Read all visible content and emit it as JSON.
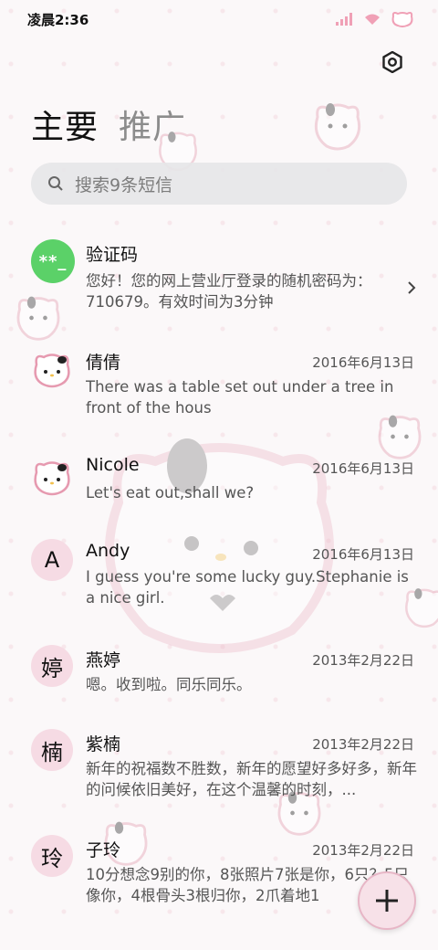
{
  "status_bar": {
    "time": "凌晨2:36"
  },
  "tabs": [
    {
      "label": "主要",
      "active": true
    },
    {
      "label": "推广",
      "active": false
    }
  ],
  "search": {
    "placeholder": "搜索9条短信"
  },
  "conversations": [
    {
      "avatar_type": "code",
      "avatar_text": "**_",
      "name": "验证码",
      "date": "",
      "message": "您好！您的网上营业厅登录的随机密码为：710679。有效时间为3分钟"
    },
    {
      "avatar_type": "kitty",
      "avatar_text": "",
      "name": "倩倩",
      "date": "2016年6月13日",
      "message": "There was a table set out under a tree in front of the hous"
    },
    {
      "avatar_type": "kitty",
      "avatar_text": "",
      "name": "Nicole",
      "date": "2016年6月13日",
      "message": "Let's eat out,shall we?"
    },
    {
      "avatar_type": "letter",
      "avatar_text": "A",
      "name": "Andy",
      "date": "2016年6月13日",
      "message": "I guess you're some lucky guy.Stephanie is a nice girl."
    },
    {
      "avatar_type": "letter",
      "avatar_text": "婷",
      "name": "燕婷",
      "date": "2013年2月22日",
      "message": "嗯。收到啦。同乐同乐。"
    },
    {
      "avatar_type": "letter",
      "avatar_text": "楠",
      "name": "紫楠",
      "date": "2013年2月22日",
      "message": "新年的祝福数不胜数，新年的愿望好多好多，新年的问候依旧美好，在这个温馨的时刻，..."
    },
    {
      "avatar_type": "letter",
      "avatar_text": "玲",
      "name": "子玲",
      "date": "2013年2月22日",
      "message": "10分想念9别的你，8张照片7张是你，6只？5只像你，4根骨头3根归你，2爪着地1"
    }
  ],
  "colors": {
    "accent_pink": "#f6dbe4",
    "code_green": "#5bd168"
  },
  "icons": [
    "settings-icon",
    "search-icon",
    "chevron-right-icon",
    "plus-icon",
    "signal-icon",
    "wifi-icon",
    "battery-icon"
  ]
}
